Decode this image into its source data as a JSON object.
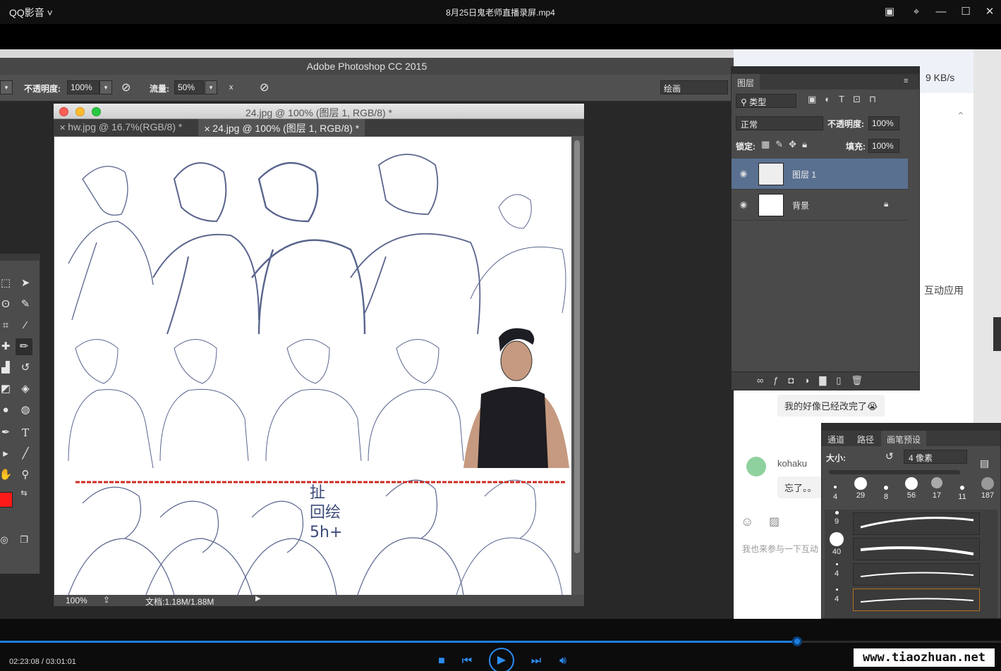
{
  "player": {
    "app_name": "QQ影音",
    "app_chevron": "˅",
    "file_title": "8月25日鬼老师直播录屏.mp4",
    "win_icons": [
      "pip-icon",
      "pin-icon",
      "minimize-icon",
      "maximize-icon",
      "close-icon"
    ],
    "time": "02:23:08 / 03:01:01",
    "progress_fraction": 0.796,
    "watermark": "www.tiaozhuan.net",
    "accent_color": "#1e7fe0"
  },
  "ps": {
    "app_title": "Adobe Photoshop CC 2015",
    "options": {
      "opacity_label": "不透明度:",
      "opacity_value": "100%",
      "flow_label": "流量:",
      "flow_value": "50%",
      "workspace": "绘画"
    },
    "document": {
      "title": "24.jpg @ 100% (图层 1, RGB/8) *",
      "tabs": [
        {
          "label": "hw.jpg @ 16.7%(RGB/8) *"
        },
        {
          "label": "24.jpg @ 100% (图层 1, RGB/8) *"
        }
      ],
      "zoom": "100%",
      "doc_size": "文档:1.18M/1.88M",
      "canvas_text": "扯\n回绘\n5h+"
    },
    "layers_panel": {
      "tab": "图层",
      "filter": "类型",
      "blend_mode": "正常",
      "opacity_label": "不透明度:",
      "opacity_value": "100%",
      "lock_label": "锁定:",
      "fill_label": "填充:",
      "fill_value": "100%",
      "layers": [
        {
          "name": "图层 1",
          "selected": true
        },
        {
          "name": "背景",
          "selected": false
        }
      ]
    },
    "brush_panel": {
      "tabs": [
        "通道",
        "路径",
        "画笔预设"
      ],
      "size_label": "大小:",
      "size_value": "4 像素",
      "tips": [
        "4",
        "29",
        "8",
        "56",
        "17",
        "11",
        "187"
      ],
      "stroke_sizes": [
        "9",
        "40",
        "4",
        "4"
      ]
    }
  },
  "chat": {
    "speed": "9 KB/s",
    "interactive_apps": "互动应用",
    "message_1": "我的好像已经改完了😭",
    "user": "kohaku",
    "message_2": "忘了。。",
    "input_placeholder": "我也来参与一下互动"
  }
}
